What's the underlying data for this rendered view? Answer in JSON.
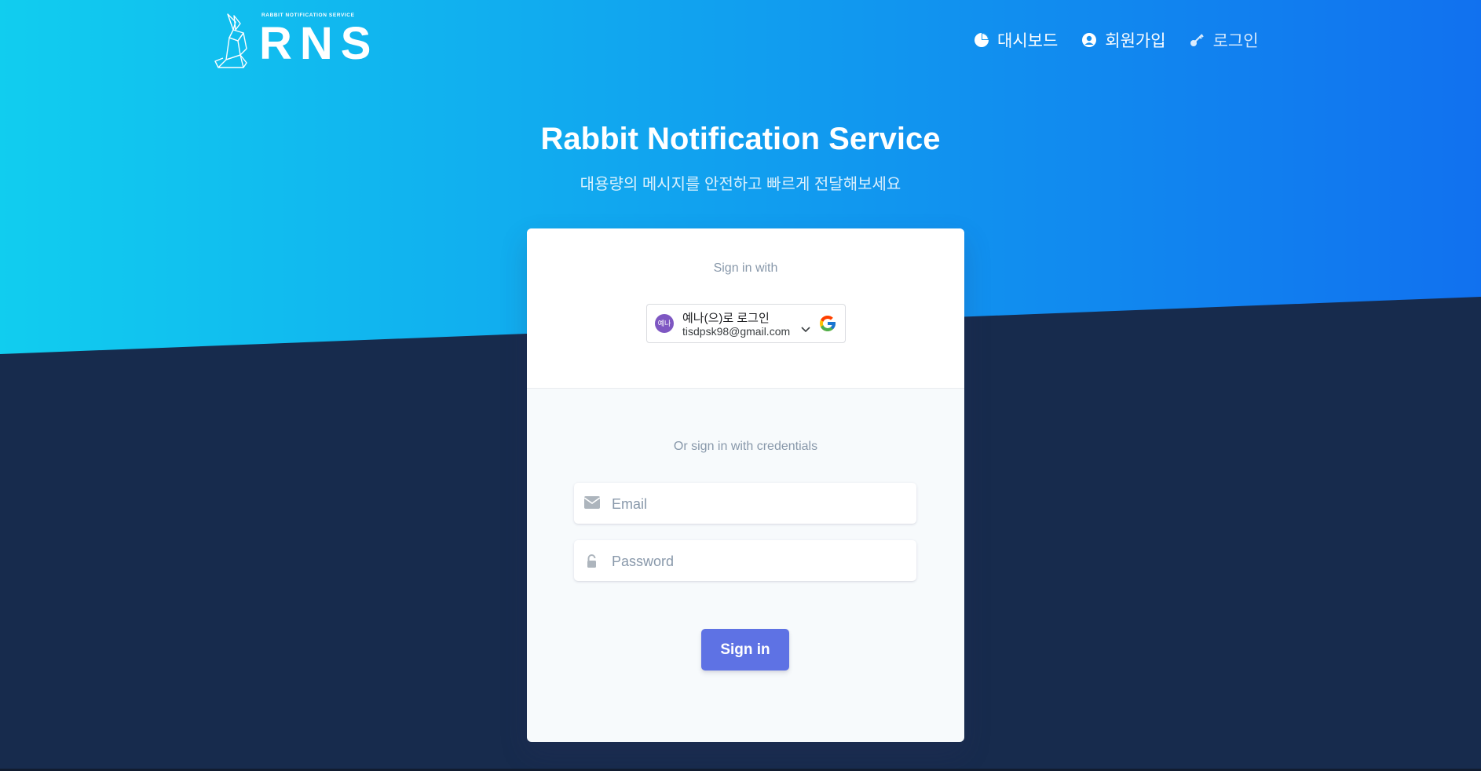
{
  "brand": {
    "tagline": "RABBIT NOTIFICATION SERVICE",
    "name": "RNS",
    "logo_icon": "rabbit-origami-icon"
  },
  "nav": {
    "items": [
      {
        "label": "대시보드",
        "icon": "pie-chart-icon"
      },
      {
        "label": "회원가입",
        "icon": "user-circle-icon"
      },
      {
        "label": "로그인",
        "icon": "key-icon"
      }
    ]
  },
  "hero": {
    "title": "Rabbit Notification Service",
    "subtitle": "대용량의 메시지를 안전하고 빠르게 전달해보세요"
  },
  "signin": {
    "social_label": "Sign in with",
    "google": {
      "avatar_text": "예나",
      "name_line": "예나(으)로 로그인",
      "email": "tisdpsk98@gmail.com"
    },
    "credentials_label": "Or sign in with credentials",
    "email_placeholder": "Email",
    "password_placeholder": "Password",
    "submit_label": "Sign in"
  },
  "colors": {
    "gradient_start": "#11cdef",
    "gradient_end": "#1171ef",
    "background_dark": "#172b4d",
    "primary_button": "#5e72e4",
    "avatar": "#7e57c2"
  }
}
